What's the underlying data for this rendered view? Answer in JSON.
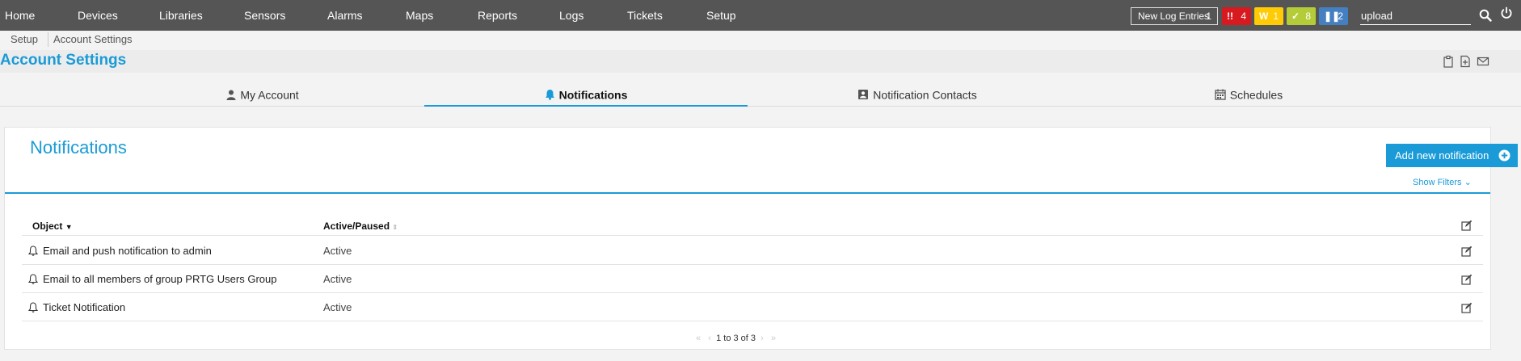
{
  "nav": {
    "items": [
      "Home",
      "Devices",
      "Libraries",
      "Sensors",
      "Alarms",
      "Maps",
      "Reports",
      "Logs",
      "Tickets",
      "Setup"
    ],
    "log_entries_label": "New Log Entries",
    "log_entries_count": "1",
    "status_badges": [
      {
        "icon": "alarm-icon",
        "color": "#d71920",
        "count": "4"
      },
      {
        "icon": "warning-icon",
        "color": "#ffcb05",
        "count": "1"
      },
      {
        "icon": "ok-icon",
        "color": "#b4cc38",
        "count": "8"
      },
      {
        "icon": "paused-icon",
        "color": "#447fc1",
        "count": "2"
      }
    ],
    "search_value": "upload"
  },
  "breadcrumb": [
    "Setup",
    "Account Settings"
  ],
  "page_title": "Account Settings",
  "tabs": [
    {
      "label": "My Account",
      "icon": "user-icon"
    },
    {
      "label": "Notifications",
      "icon": "bell-icon",
      "active": true
    },
    {
      "label": "Notification Contacts",
      "icon": "contact-card-icon"
    },
    {
      "label": "Schedules",
      "icon": "calendar-icon"
    }
  ],
  "card": {
    "title": "Notifications",
    "add_button": "Add new notification",
    "show_filters": "Show Filters",
    "columns": [
      "Object",
      "Active/Paused"
    ],
    "rows": [
      {
        "name": "Email and push notification to admin",
        "status": "Active"
      },
      {
        "name": "Email to all members of group PRTG Users Group",
        "status": "Active"
      },
      {
        "name": "Ticket Notification",
        "status": "Active"
      }
    ],
    "pager": "1 to 3 of 3"
  },
  "colors": {
    "accent": "#1a9bd7",
    "topbar": "#555555"
  }
}
